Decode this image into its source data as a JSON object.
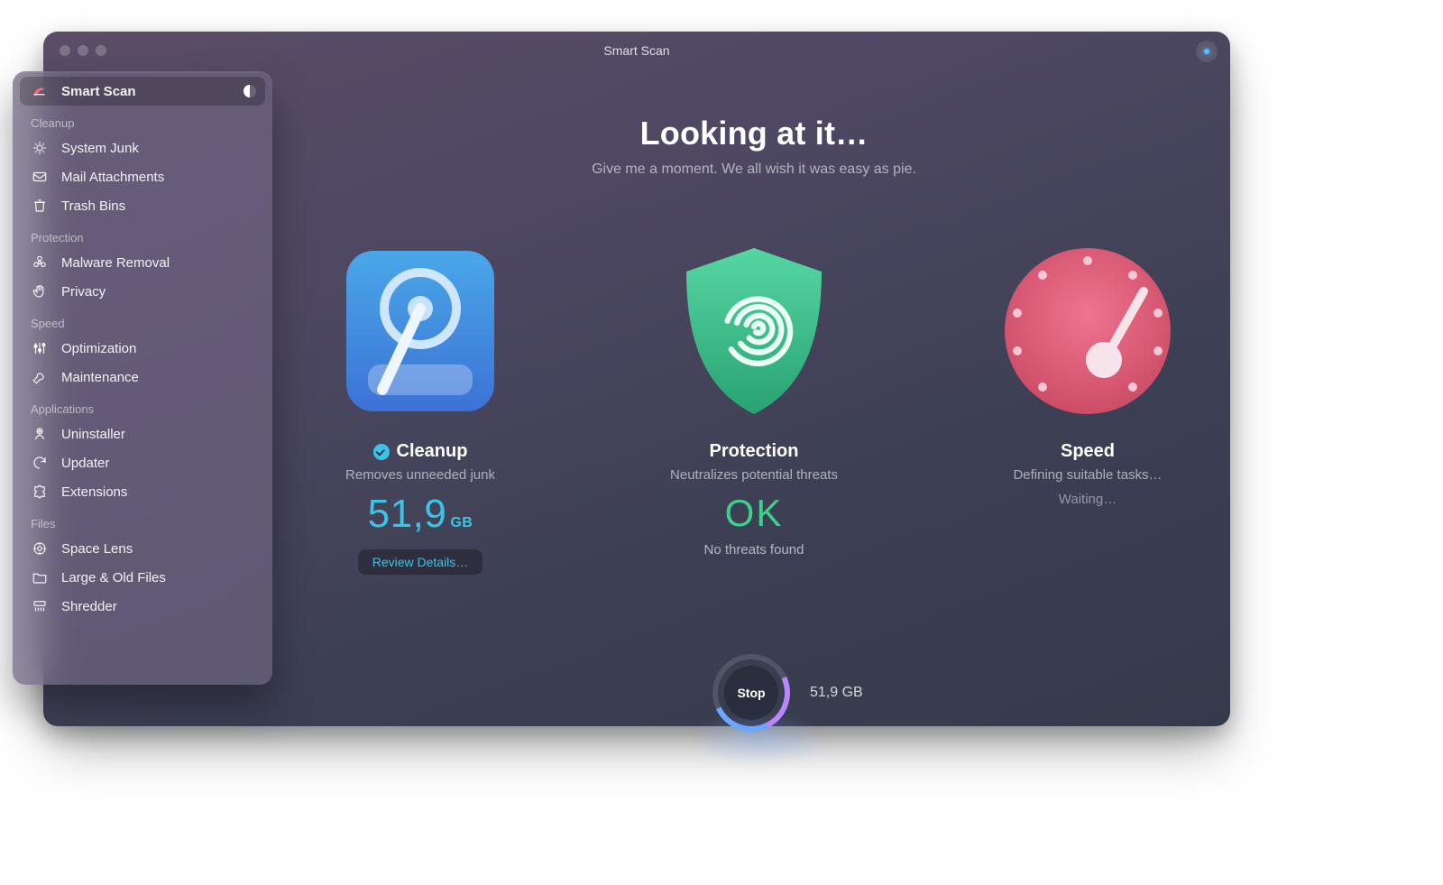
{
  "title": "Smart Scan",
  "heading": {
    "title": "Looking at it…",
    "subtitle": "Give me a moment. We all wish it was easy as pie."
  },
  "sidebar": {
    "active": "Smart Scan",
    "groups": [
      {
        "header": null,
        "items": [
          {
            "icon": "radar",
            "label": "Smart Scan"
          }
        ]
      },
      {
        "header": "Cleanup",
        "items": [
          {
            "icon": "gear-trash",
            "label": "System Junk"
          },
          {
            "icon": "mail",
            "label": "Mail Attachments"
          },
          {
            "icon": "trash",
            "label": "Trash Bins"
          }
        ]
      },
      {
        "header": "Protection",
        "items": [
          {
            "icon": "biohazard",
            "label": "Malware Removal"
          },
          {
            "icon": "hand",
            "label": "Privacy"
          }
        ]
      },
      {
        "header": "Speed",
        "items": [
          {
            "icon": "sliders",
            "label": "Optimization"
          },
          {
            "icon": "wrench",
            "label": "Maintenance"
          }
        ]
      },
      {
        "header": "Applications",
        "items": [
          {
            "icon": "uninstall",
            "label": "Uninstaller"
          },
          {
            "icon": "updater",
            "label": "Updater"
          },
          {
            "icon": "puzzle",
            "label": "Extensions"
          }
        ]
      },
      {
        "header": "Files",
        "items": [
          {
            "icon": "lens",
            "label": "Space Lens"
          },
          {
            "icon": "folder",
            "label": "Large & Old Files"
          },
          {
            "icon": "shredder",
            "label": "Shredder"
          }
        ]
      }
    ]
  },
  "cards": {
    "cleanup": {
      "title": "Cleanup",
      "subtitle": "Removes unneeded junk",
      "value": "51,9",
      "unit": "GB",
      "action": "Review Details…",
      "completed": true
    },
    "protection": {
      "title": "Protection",
      "subtitle": "Neutralizes potential threats",
      "value": "OK",
      "status": "No threats found"
    },
    "speed": {
      "title": "Speed",
      "subtitle": "Defining suitable tasks…",
      "status": "Waiting…"
    }
  },
  "footer": {
    "action": "Stop",
    "progress_label": "51,9 GB"
  }
}
